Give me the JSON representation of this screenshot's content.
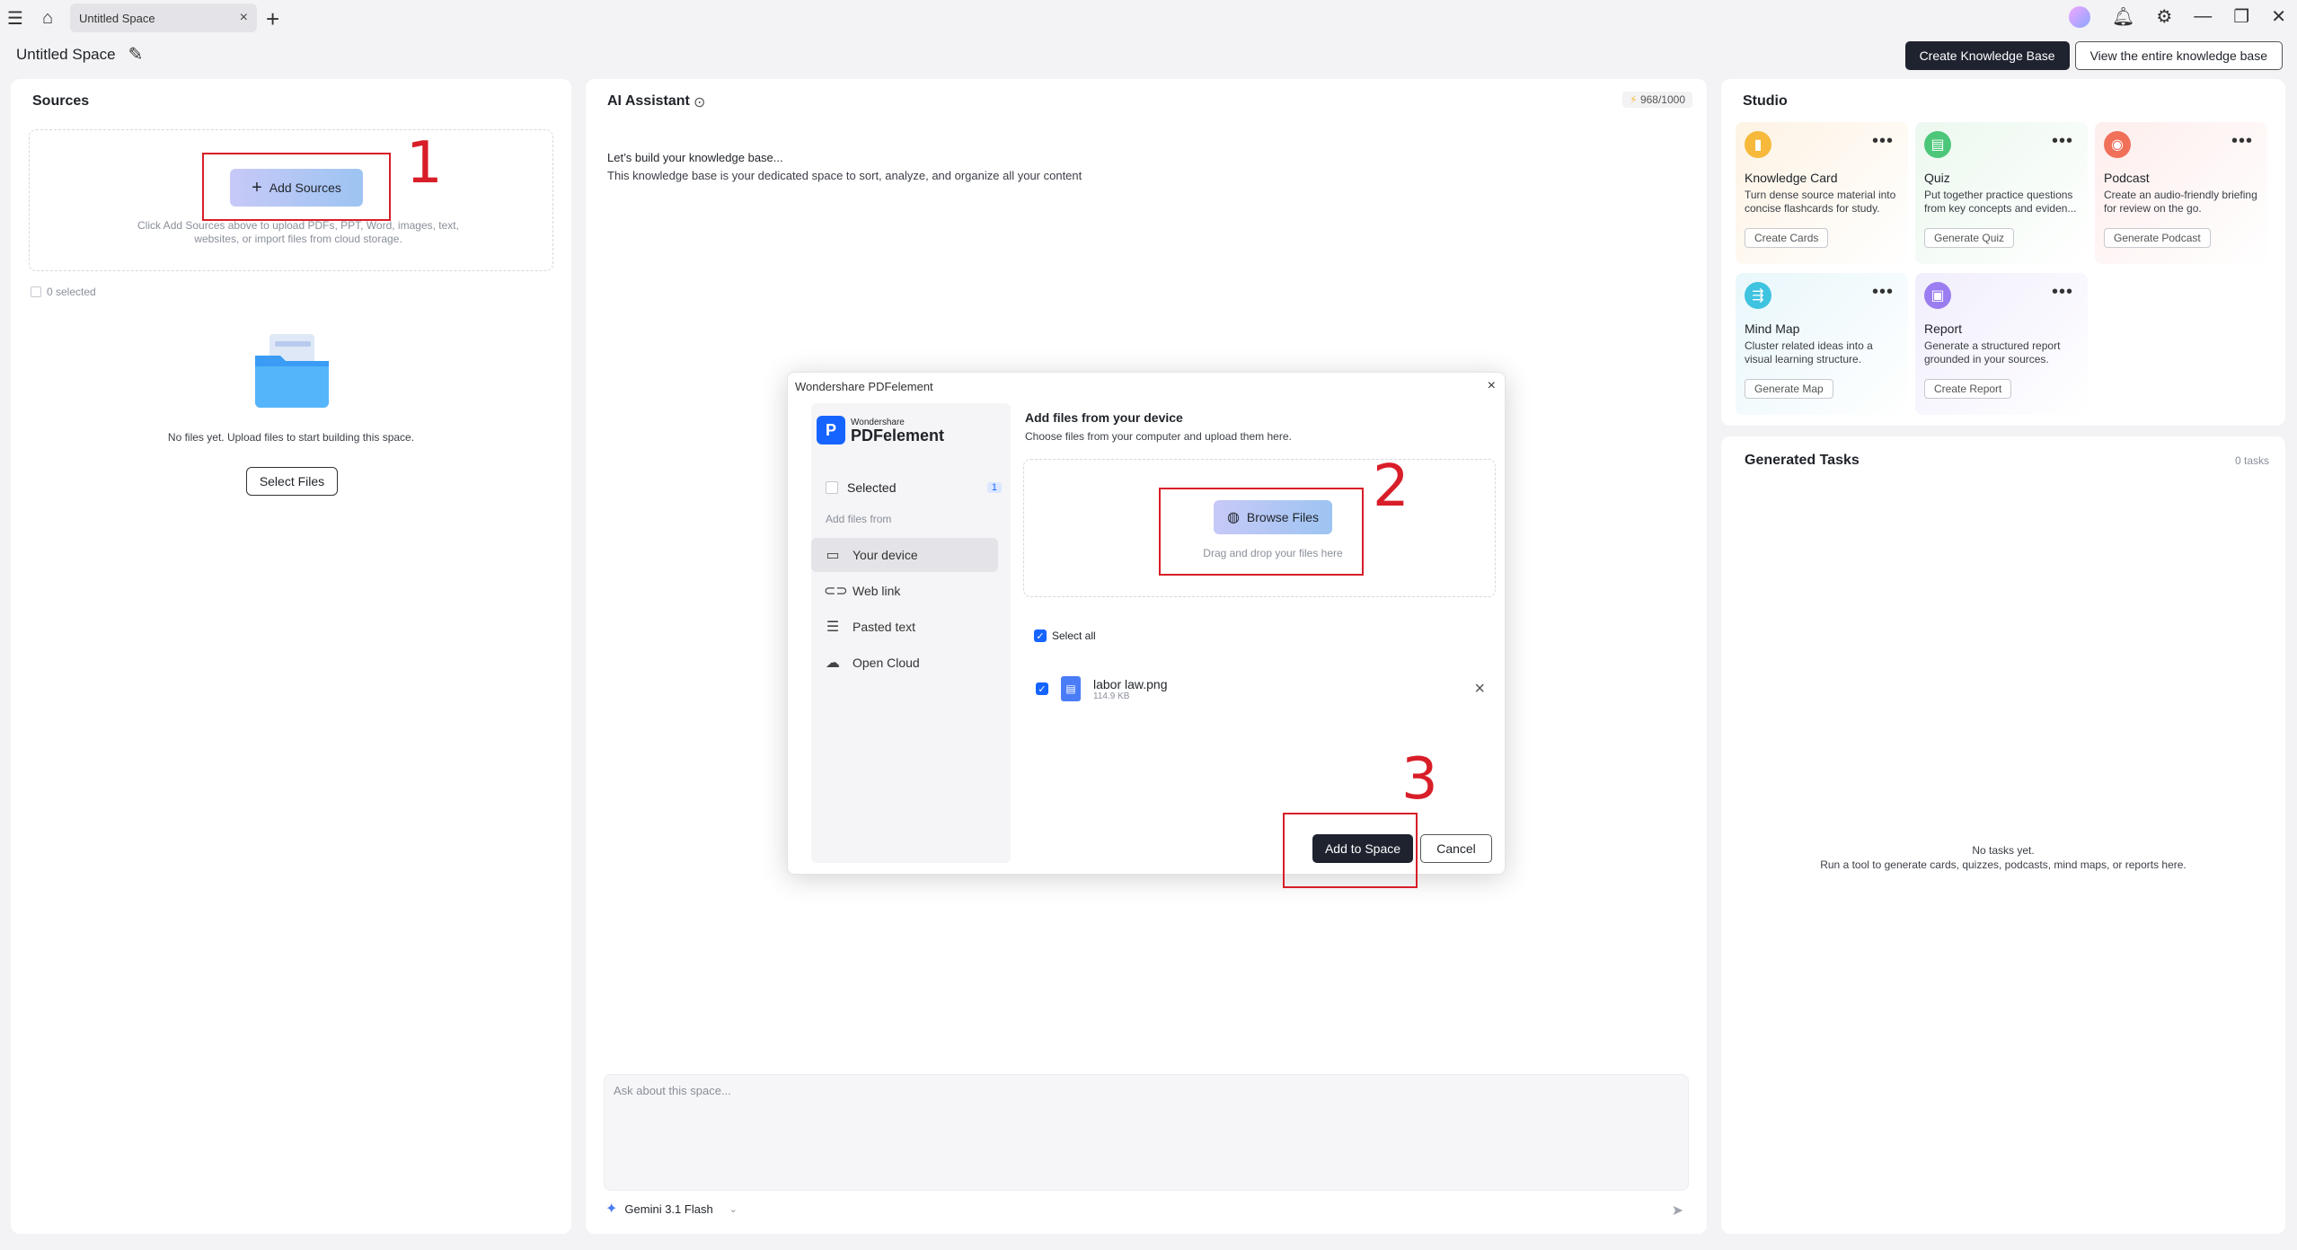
{
  "titlebar": {
    "tab_label": "Untitled Space",
    "icons": [
      "menu-icon",
      "home-icon",
      "close-icon",
      "plus-icon",
      "avatar",
      "bell-icon",
      "gear-icon",
      "minimize-icon",
      "restore-icon",
      "close-window-icon"
    ]
  },
  "header": {
    "space_title": "Untitled Space",
    "create_kb": "Create Knowledge Base",
    "view_kb": "View the entire knowledge base"
  },
  "sources": {
    "title": "Sources",
    "add_sources": "Add Sources",
    "hint": "Click Add Sources above to upload PDFs, PPT, Word, images, text, websites, or import files from cloud storage.",
    "selected": "0 selected",
    "empty": "No files yet. Upload files to start building this space.",
    "select_files": "Select Files"
  },
  "assistant": {
    "title": "AI Assistant",
    "credits": "968/1000",
    "intro_title": "Let’s build your knowledge base...",
    "intro_body": "This knowledge base is your dedicated space to sort, analyze, and organize all your content",
    "ask_placeholder": "Ask about this space...",
    "model": "Gemini 3.1 Flash"
  },
  "studio": {
    "title": "Studio",
    "cards": [
      {
        "title": "Knowledge Card",
        "desc": "Turn dense source material into concise flashcards for study.",
        "btn": "Create Cards",
        "color": "#f6b93b",
        "bg": "#fdf3e4"
      },
      {
        "title": "Quiz",
        "desc": "Put together practice questions from key concepts and eviden...",
        "btn": "Generate Quiz",
        "color": "#4cc77a",
        "bg": "#ecf8ef"
      },
      {
        "title": "Podcast",
        "desc": "Create an audio-friendly briefing for review on the go.",
        "btn": "Generate Podcast",
        "color": "#f0705a",
        "bg": "#fdeeed"
      },
      {
        "title": "Mind Map",
        "desc": "Cluster related ideas into a visual learning structure.",
        "btn": "Generate Map",
        "color": "#3ec3e0",
        "bg": "#e9f7fb"
      },
      {
        "title": "Report",
        "desc": "Generate a structured report grounded in your sources.",
        "btn": "Create Report",
        "color": "#9a7df0",
        "bg": "#f1eefc"
      }
    ]
  },
  "tasks": {
    "title": "Generated Tasks",
    "count": "0 tasks",
    "empty1": "No tasks yet.",
    "empty2": "Run a tool to generate cards, quizzes, podcasts, mind maps, or reports here."
  },
  "modal": {
    "title": "Wondershare PDFelement",
    "logo_small": "Wondershare",
    "logo_big": "PDFelement",
    "selected_label": "Selected",
    "selected_count": "1",
    "add_from": "Add files from",
    "items": [
      "Your device",
      "Web link",
      "Pasted text",
      "Open Cloud"
    ],
    "main_title": "Add files from your device",
    "main_sub": "Choose files from your computer and upload them here.",
    "browse": "Browse Files",
    "drag_hint": "Drag and drop your files here",
    "select_all": "Select all",
    "file_name": "labor law.png",
    "file_size": "114.9 KB",
    "add_to_space": "Add to Space",
    "cancel": "Cancel"
  },
  "annotations": {
    "n1": "1",
    "n2": "2",
    "n3": "3",
    "color": "#d81e28"
  }
}
